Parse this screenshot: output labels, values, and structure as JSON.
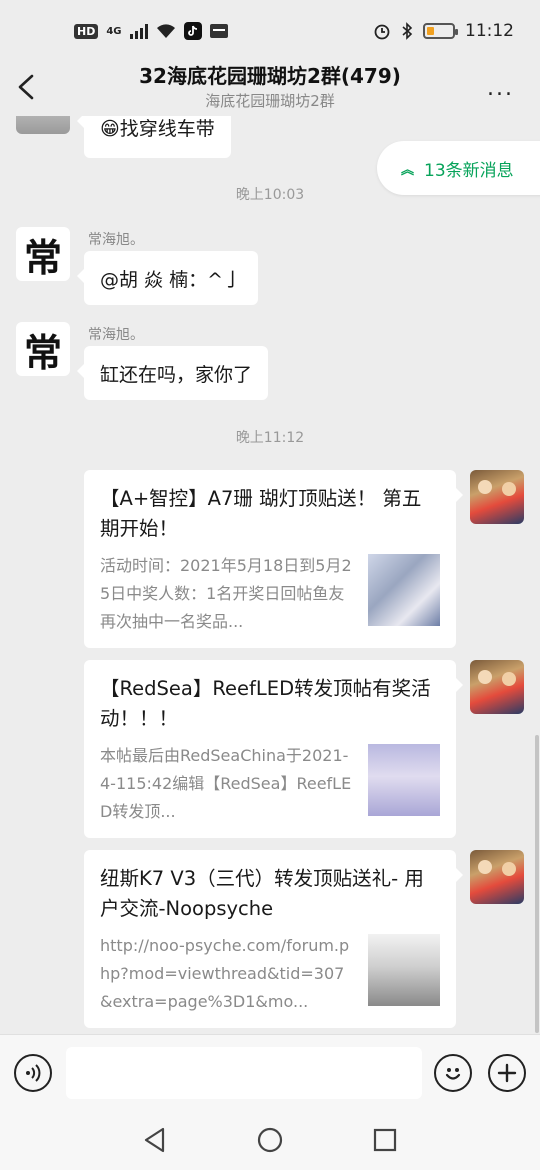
{
  "status_bar": {
    "hd": "HD",
    "network": "4G",
    "time": "11:12"
  },
  "header": {
    "title": "32海底花园珊瑚坊2群(479)",
    "subtitle": "海底花园珊瑚坊2群",
    "more": "..."
  },
  "chat": {
    "partial_message": "😁找穿线车带",
    "new_messages_label": "13条新消息",
    "time_1": "晚上10:03",
    "time_2": "晚上11:12",
    "messages": [
      {
        "sender": "常海旭。",
        "avatar_char": "常",
        "text": "@胡 焱 楠：^亅"
      },
      {
        "sender": "常海旭。",
        "avatar_char": "常",
        "text": "缸还在吗，家你了"
      }
    ],
    "cards": [
      {
        "title": "【A+智控】A7珊 瑚灯顶贴送！ 第五期开始！",
        "desc": "活动时间：2021年5月18日到5月25日中奖人数：1名开奖日回帖鱼友再次抽中一名奖品..."
      },
      {
        "title": "【RedSea】ReefLED转发顶帖有奖活动！！！",
        "desc": "本帖最后由RedSeaChina于2021-4-115:42编辑【RedSea】ReefLED转发顶..."
      },
      {
        "title": "纽斯K7 V3（三代）转发顶贴送礼- 用户交流-Noopsyche",
        "desc": "http://noo-psyche.com/forum.php?mod=viewthread&tid=307&extra=page%3D1&mo..."
      }
    ]
  },
  "input": {
    "placeholder": ""
  },
  "icons": {
    "back": "back-arrow-icon",
    "more": "more-dots-icon",
    "voice": "voice-icon",
    "emoji": "emoji-icon",
    "plus": "plus-icon",
    "nav_back": "nav-back-icon",
    "nav_home": "nav-home-icon",
    "nav_recent": "nav-recent-icon"
  },
  "colors": {
    "accent_green": "#07a35a",
    "background": "#ededed",
    "battery": "#f0a020"
  }
}
